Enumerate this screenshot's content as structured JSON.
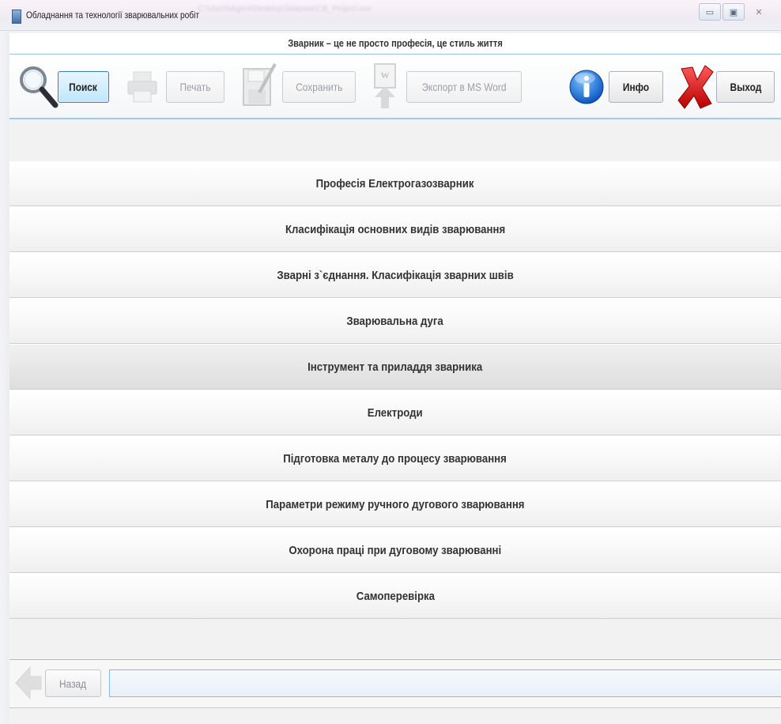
{
  "window": {
    "title": "Обладнання та технології зварювальних робіт",
    "title_ghost": "C:\\Users\\Agent\\Desktop\\Зварник\\CB_Project.exe",
    "buttons": {
      "minimize": "▭",
      "maximize": "▣",
      "close": "✕"
    }
  },
  "slogan": "Зварник – це не просто професія, це стиль життя",
  "toolbar": {
    "search_label": "Поиск",
    "print_label": "Печать",
    "save_label": "Сохранить",
    "export_label": "Экспорт в MS Word",
    "info_label": "Инфо",
    "exit_label": "Выход"
  },
  "menu": {
    "items": [
      {
        "label": "Професія Електрогазозварник"
      },
      {
        "label": "Класифікація основних видів зварювання"
      },
      {
        "label": "Зварні з`єднання. Класифікація зварних швів"
      },
      {
        "label": "Зварювальна дуга"
      },
      {
        "label": "Інструмент та приладдя зварника"
      },
      {
        "label": "Електроди"
      },
      {
        "label": "Підготовка металу до процесу зварювання"
      },
      {
        "label": "Параметри режиму ручного дугового зварювання"
      },
      {
        "label": "Охорона праці при дуговому зварюванні"
      },
      {
        "label": "Самоперевірка"
      }
    ]
  },
  "navigation": {
    "back_label": "Назад",
    "path_value": ""
  },
  "colors": {
    "accent_border": "#a8c8ea",
    "active_button": "#bee6fd",
    "info_icon": "#1a6fd0",
    "exit_icon": "#d01616"
  },
  "icons": {
    "search": "magnifier-icon",
    "print": "printer-icon",
    "save": "save-disk-icon",
    "export": "word-export-icon",
    "info": "info-icon",
    "exit": "red-x-icon",
    "back": "back-arrow-icon"
  }
}
